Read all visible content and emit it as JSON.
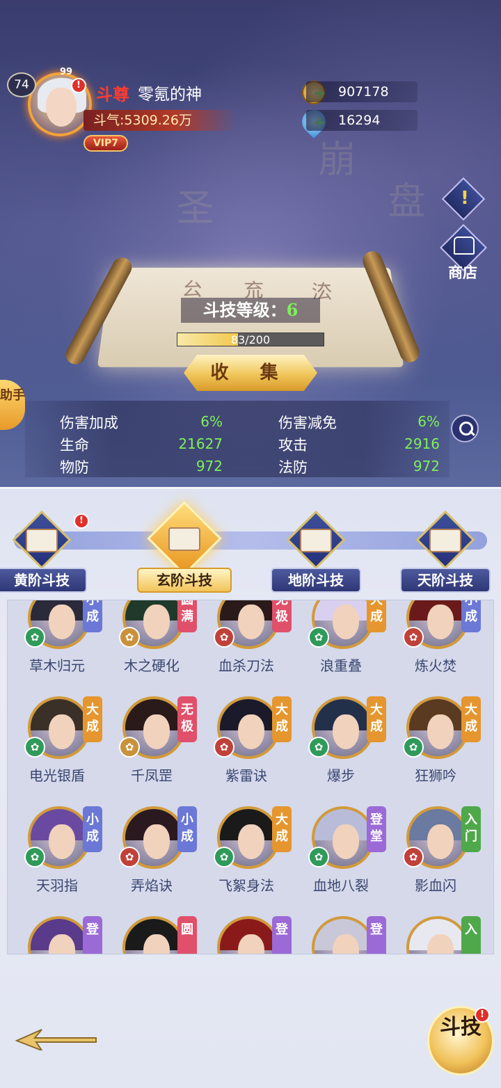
{
  "player": {
    "level": "74",
    "rank": "斗尊",
    "name": "零氪的神",
    "power": "斗气:5309.26万",
    "vip": "VIP7",
    "badge": "99",
    "alert": "!"
  },
  "resources": {
    "gold": "907178",
    "crystal": "16294"
  },
  "side_buttons": {
    "info_symbol": "!",
    "shop_label": "商店"
  },
  "skill_scroll": {
    "level_label": "斗技等级：",
    "level_value": "6",
    "exp_current": 83,
    "exp_max": 200,
    "exp_text": "83/200",
    "collect_label": "收 集"
  },
  "helper_label": "助手",
  "stats": [
    {
      "label": "伤害加成",
      "value": "6%"
    },
    {
      "label": "伤害减免",
      "value": "6%"
    },
    {
      "label": "生命",
      "value": "21627"
    },
    {
      "label": "攻击",
      "value": "2916"
    },
    {
      "label": "物防",
      "value": "972"
    },
    {
      "label": "法防",
      "value": "972"
    }
  ],
  "tabs": [
    {
      "label": "黄阶斗技",
      "active": false,
      "alert": "!"
    },
    {
      "label": "玄阶斗技",
      "active": true
    },
    {
      "label": "地阶斗技",
      "active": false
    },
    {
      "label": "天阶斗技",
      "active": false
    }
  ],
  "skills": [
    {
      "name": "草木归元",
      "rank": "小成",
      "rank_color": "#6b78d6"
    },
    {
      "name": "木之硬化",
      "rank": "圆满",
      "rank_color": "#e0506a"
    },
    {
      "name": "血杀刀法",
      "rank": "无极",
      "rank_color": "#e0506a"
    },
    {
      "name": "浪重叠",
      "rank": "大成",
      "rank_color": "#e5962e"
    },
    {
      "name": "炼火焚",
      "rank": "小成",
      "rank_color": "#6b78d6"
    },
    {
      "name": "电光银盾",
      "rank": "大成",
      "rank_color": "#e5962e"
    },
    {
      "name": "千凤罡",
      "rank": "无极",
      "rank_color": "#e0506a"
    },
    {
      "name": "紫雷诀",
      "rank": "大成",
      "rank_color": "#e5962e"
    },
    {
      "name": "爆步",
      "rank": "大成",
      "rank_color": "#e5962e"
    },
    {
      "name": "狂狮吟",
      "rank": "大成",
      "rank_color": "#e5962e"
    },
    {
      "name": "天羽指",
      "rank": "小成",
      "rank_color": "#6b78d6"
    },
    {
      "name": "弄焰诀",
      "rank": "小成",
      "rank_color": "#6b78d6"
    },
    {
      "name": "飞絮身法",
      "rank": "大成",
      "rank_color": "#e5962e"
    },
    {
      "name": "血地八裂",
      "rank": "登堂",
      "rank_color": "#9b6ad6"
    },
    {
      "name": "影血闪",
      "rank": "入门",
      "rank_color": "#4fa84a"
    },
    {
      "name": "",
      "rank": "登",
      "rank_color": "#9b6ad6"
    },
    {
      "name": "",
      "rank": "圆",
      "rank_color": "#e0506a"
    },
    {
      "name": "",
      "rank": "登",
      "rank_color": "#9b6ad6"
    },
    {
      "name": "",
      "rank": "登",
      "rank_color": "#9b6ad6"
    },
    {
      "name": "",
      "rank": "入",
      "rank_color": "#4fa84a"
    }
  ],
  "fight_button": {
    "label": "斗技",
    "alert": "!"
  }
}
